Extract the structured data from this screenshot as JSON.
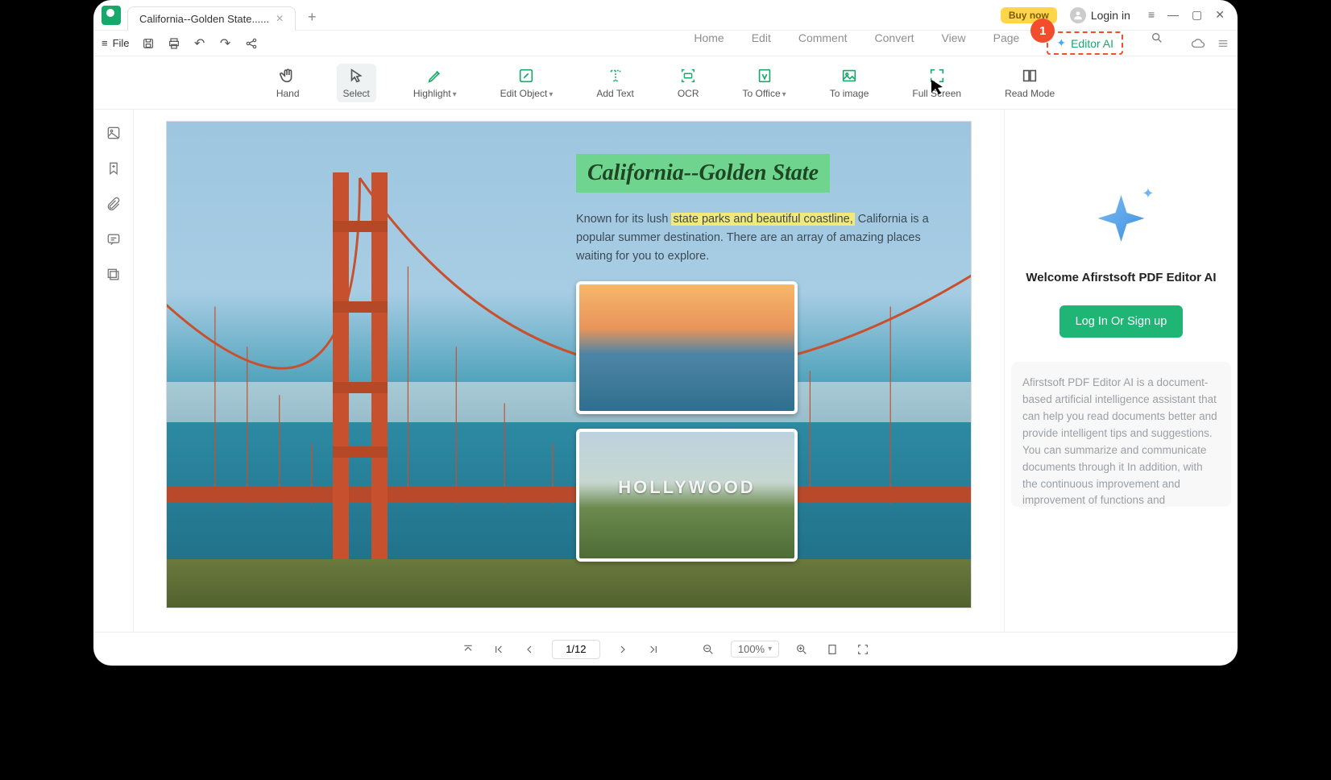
{
  "titlebar": {
    "tab_title": "California--Golden State......",
    "buy_now": "Buy now",
    "login": "Login in"
  },
  "quickbar": {
    "file_label": "File"
  },
  "menubar": {
    "home": "Home",
    "edit": "Edit",
    "comment": "Comment",
    "convert": "Convert",
    "view": "View",
    "page": "Page",
    "editor_ai": "Editor AI",
    "callout_num": "1"
  },
  "ribbon": {
    "hand": "Hand",
    "select": "Select",
    "highlight": "Highlight",
    "edit_object": "Edit Object",
    "add_text": "Add Text",
    "ocr": "OCR",
    "to_office": "To Office",
    "to_image": "To image",
    "fullscreen": "Full Screen",
    "read_mode": "Read Mode"
  },
  "document": {
    "title": "California--Golden State",
    "para_pre": "Known for its lush ",
    "para_hl": "state parks and beautiful coastline,",
    "para_post": " California is a popular summer destination. There are an array of amazing places waiting for you to explore.",
    "hollywood": "HOLLYWOOD"
  },
  "ai_panel": {
    "welcome": "Welcome Afirstsoft PDF Editor AI",
    "login_btn": "Log In Or Sign up",
    "description": "Afirstsoft PDF Editor AI is a document-based artificial intelligence assistant that can help you read documents better and provide intelligent tips and suggestions. You can summarize and communicate documents through it In addition, with the continuous improvement and improvement of functions and capabilities, it will become your reliable"
  },
  "footer": {
    "page_display": "1/12",
    "zoom_display": "100%"
  }
}
